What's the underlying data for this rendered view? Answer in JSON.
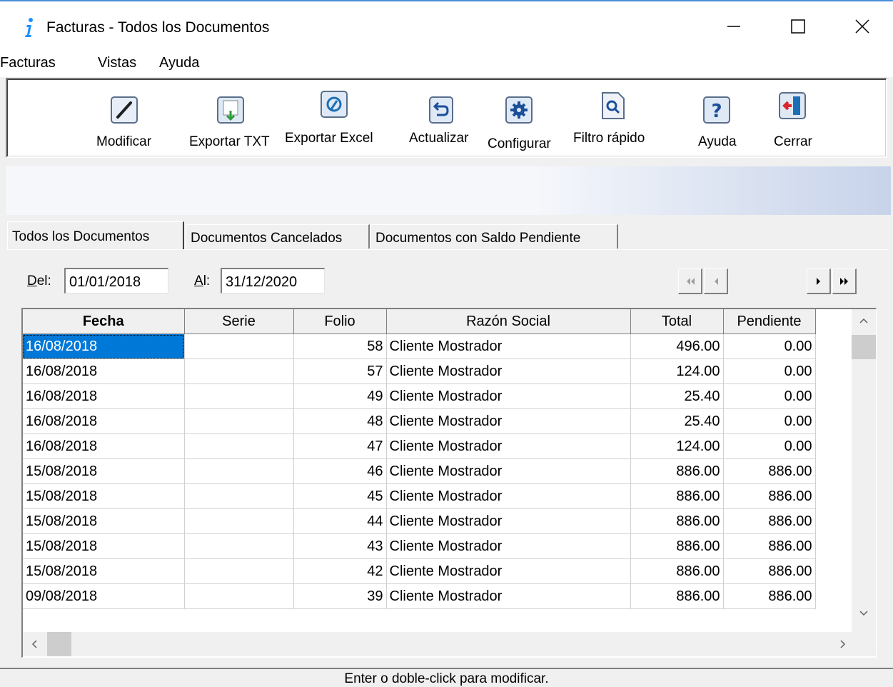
{
  "window": {
    "title": "Facturas - Todos los Documentos"
  },
  "menu": [
    "Facturas",
    "Vistas",
    "Ayuda"
  ],
  "toolbar": {
    "modificar": "Modificar",
    "exportar_txt": "Exportar TXT",
    "exportar_excel": "Exportar Excel",
    "actualizar": "Actualizar",
    "configurar": "Configurar",
    "filtro": "Filtro rápido",
    "ayuda": "Ayuda",
    "cerrar": "Cerrar"
  },
  "tabs": [
    "Todos los Documentos",
    "Documentos Cancelados",
    "Documentos con Saldo Pendiente"
  ],
  "filter": {
    "del_label_ul": "D",
    "del_label_rest": "el:",
    "del_value": "01/01/2018",
    "al_label_ul": "A",
    "al_label_rest": "l:",
    "al_value": "31/12/2020"
  },
  "grid": {
    "columns": [
      "Fecha",
      "Serie",
      "Folio",
      "Razón Social",
      "Total",
      "Pendiente"
    ],
    "rows": [
      [
        "16/08/2018",
        "",
        "58",
        "Cliente Mostrador",
        "496.00",
        "0.00"
      ],
      [
        "16/08/2018",
        "",
        "57",
        "Cliente Mostrador",
        "124.00",
        "0.00"
      ],
      [
        "16/08/2018",
        "",
        "49",
        "Cliente Mostrador",
        "25.40",
        "0.00"
      ],
      [
        "16/08/2018",
        "",
        "48",
        "Cliente Mostrador",
        "25.40",
        "0.00"
      ],
      [
        "16/08/2018",
        "",
        "47",
        "Cliente Mostrador",
        "124.00",
        "0.00"
      ],
      [
        "15/08/2018",
        "",
        "46",
        "Cliente Mostrador",
        "886.00",
        "886.00"
      ],
      [
        "15/08/2018",
        "",
        "45",
        "Cliente Mostrador",
        "886.00",
        "886.00"
      ],
      [
        "15/08/2018",
        "",
        "44",
        "Cliente Mostrador",
        "886.00",
        "886.00"
      ],
      [
        "15/08/2018",
        "",
        "43",
        "Cliente Mostrador",
        "886.00",
        "886.00"
      ],
      [
        "15/08/2018",
        "",
        "42",
        "Cliente Mostrador",
        "886.00",
        "886.00"
      ],
      [
        "09/08/2018",
        "",
        "39",
        "Cliente Mostrador",
        "886.00",
        "886.00"
      ]
    ]
  },
  "status": "Enter o doble-click para modificar."
}
